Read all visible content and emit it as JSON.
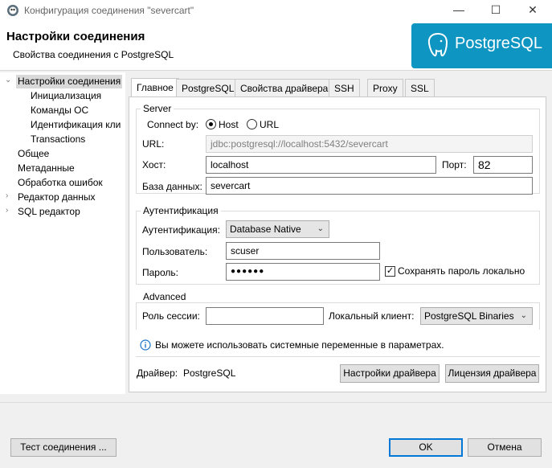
{
  "window": {
    "title": "Конфигурация соединения \"severcart\"",
    "controls": {
      "minimize": "—",
      "maximize": "☐",
      "close": "✕"
    },
    "icon": "dbeaver-icon"
  },
  "header": {
    "title": "Настройки соединения",
    "subtitle": "Свойства соединения с PostgreSQL",
    "logo_text": "PostgreSQL",
    "logo_color": "#0f95c2"
  },
  "tree": {
    "items": [
      {
        "label": "Настройки соединения",
        "selected": true,
        "expanded": true
      },
      {
        "label": "Инициализация"
      },
      {
        "label": "Команды ОС"
      },
      {
        "label": "Идентификация кли"
      },
      {
        "label": "Transactions"
      },
      {
        "label": "Общее"
      },
      {
        "label": "Метаданные"
      },
      {
        "label": "Обработка ошибок"
      },
      {
        "label": "Редактор данных",
        "expandable": true
      },
      {
        "label": "SQL редактор",
        "expandable": true
      }
    ]
  },
  "tabs": [
    {
      "label": "Главное",
      "active": true
    },
    {
      "label": "PostgreSQL"
    },
    {
      "label": "Свойства драйвера"
    },
    {
      "label": "SSH"
    },
    {
      "label": "Proxy"
    },
    {
      "label": "SSL"
    }
  ],
  "server": {
    "title": "Server",
    "connect_by_label": "Connect by:",
    "host_option": "Host",
    "url_option": "URL",
    "selected": "Host",
    "url_label": "URL:",
    "url_value": "jdbc:postgresql://localhost:5432/severcart",
    "host_label": "Хост:",
    "host_value": "localhost",
    "port_label": "Порт:",
    "port_value": "82",
    "db_label": "База данных:",
    "db_value": "severcart"
  },
  "auth": {
    "title": "Аутентификация",
    "method_label": "Аутентификация:",
    "method_value": "Database Native",
    "user_label": "Пользователь:",
    "user_value": "scuser",
    "password_label": "Пароль:",
    "password_value": "●●●●●●",
    "save_password_label": "Сохранять пароль локально",
    "save_password_checked": true
  },
  "advanced": {
    "title": "Advanced",
    "role_label": "Роль сессии:",
    "role_value": "",
    "client_label": "Локальный клиент:",
    "client_value": "PostgreSQL Binaries"
  },
  "info": {
    "text": "Вы можете использовать системные переменные в параметрах."
  },
  "driver": {
    "label": "Драйвер:",
    "value": "PostgreSQL",
    "settings_button": "Настройки драйвера",
    "license_button": "Лицензия драйвера"
  },
  "footer": {
    "test_button": "Тест соединения ...",
    "ok_button": "OK",
    "cancel_button": "Отмена"
  }
}
